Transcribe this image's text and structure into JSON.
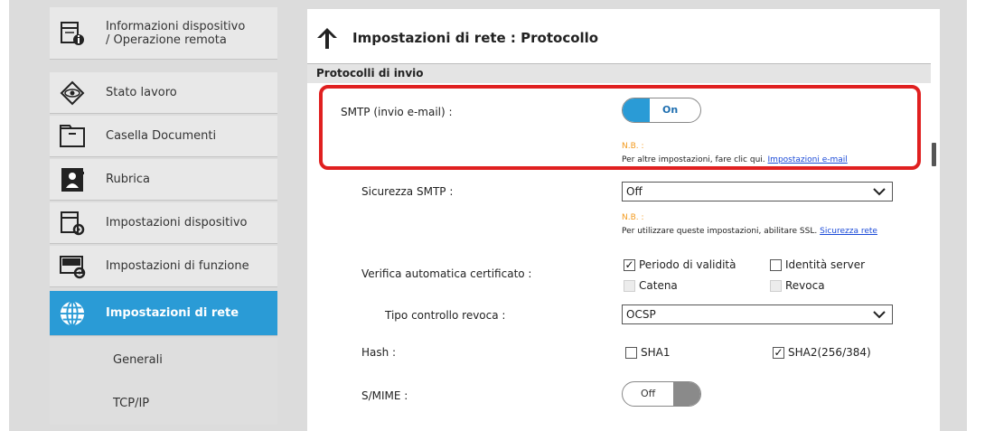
{
  "sidebar": {
    "items": [
      {
        "label": "Informazioni dispositivo / Operazione remota"
      },
      {
        "label": "Stato lavoro"
      },
      {
        "label": "Casella Documenti"
      },
      {
        "label": "Rubrica"
      },
      {
        "label": "Impostazioni dispositivo"
      },
      {
        "label": "Impostazioni di funzione"
      },
      {
        "label": "Impostazioni di rete"
      }
    ],
    "subitems": [
      {
        "label": "Generali"
      },
      {
        "label": "TCP/IP"
      }
    ]
  },
  "header": {
    "title": "Impostazioni di rete : Protocollo"
  },
  "section": {
    "title": "Protocolli di invio"
  },
  "smtp": {
    "label": "SMTP (invio e-mail) :",
    "toggle": "On",
    "note_head": "N.B. :",
    "note_text": "Per altre impostazioni, fare clic qui.",
    "note_link": "Impostazioni e-mail"
  },
  "smtp_security": {
    "label": "Sicurezza SMTP :",
    "value": "Off",
    "note_head": "N.B. :",
    "note_text": "Per utilizzare queste impostazioni, abilitare SSL.",
    "note_link": "Sicurezza rete"
  },
  "cert_check": {
    "label": "Verifica automatica certificato :",
    "options": [
      {
        "label": "Periodo di validità",
        "checked": true,
        "enabled": true
      },
      {
        "label": "Identità server",
        "checked": false,
        "enabled": true
      },
      {
        "label": "Catena",
        "checked": false,
        "enabled": false
      },
      {
        "label": "Revoca",
        "checked": false,
        "enabled": false
      }
    ]
  },
  "revocation": {
    "label": "Tipo controllo revoca :",
    "value": "OCSP"
  },
  "hash": {
    "label": "Hash :",
    "options": [
      {
        "label": "SHA1",
        "checked": false
      },
      {
        "label": "SHA2(256/384)",
        "checked": true
      }
    ]
  },
  "smime": {
    "label": "S/MIME :",
    "toggle": "Off"
  },
  "colors": {
    "accent": "#2a9bd6",
    "highlight": "#e02020",
    "note": "#f39a1e"
  }
}
